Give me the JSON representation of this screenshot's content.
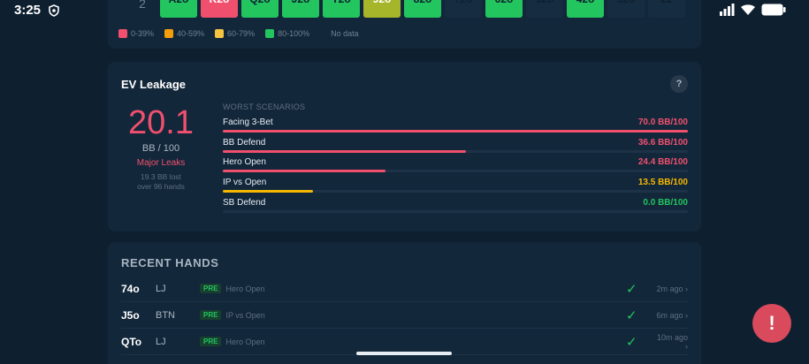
{
  "status_bar": {
    "time": "3:25"
  },
  "grid": {
    "row_label": "2",
    "cells": [
      {
        "label": "A2o",
        "color": "green"
      },
      {
        "label": "K2o",
        "color": "red"
      },
      {
        "label": "Q2o",
        "color": "green"
      },
      {
        "label": "J2o",
        "color": "green"
      },
      {
        "label": "T2o",
        "color": "green"
      },
      {
        "label": "92o",
        "color": "olive"
      },
      {
        "label": "82o",
        "color": "green"
      },
      {
        "label": "72o",
        "color": "empty"
      },
      {
        "label": "62o",
        "color": "green"
      },
      {
        "label": "52o",
        "color": "empty"
      },
      {
        "label": "42o",
        "color": "green"
      },
      {
        "label": "32o",
        "color": "empty"
      },
      {
        "label": "22",
        "color": "empty"
      }
    ],
    "legend": [
      {
        "label": "0-39%",
        "color": "#f0506e"
      },
      {
        "label": "40-59%",
        "color": "#f59e0b"
      },
      {
        "label": "60-79%",
        "color": "#f5c542"
      },
      {
        "label": "80-100%",
        "color": "#22c55e"
      },
      {
        "label": "No data",
        "color": ""
      }
    ]
  },
  "ev_leakage": {
    "title": "EV Leakage",
    "help": "?",
    "value": "20.1",
    "unit": "BB / 100",
    "status": "Major Leaks",
    "sub_line1": "19.3 BB lost",
    "sub_line2": "over 96 hands",
    "worst_label": "WORST SCENARIOS",
    "scenarios": [
      {
        "name": "Facing 3-Bet",
        "value": "70.0 BB/100",
        "fraction": 1.0,
        "color": "#f0506e"
      },
      {
        "name": "BB Defend",
        "value": "36.6 BB/100",
        "fraction": 0.523,
        "color": "#f0506e"
      },
      {
        "name": "Hero Open",
        "value": "24.4 BB/100",
        "fraction": 0.349,
        "color": "#f0506e"
      },
      {
        "name": "IP vs Open",
        "value": "13.5 BB/100",
        "fraction": 0.193,
        "color": "#f5b700"
      },
      {
        "name": "SB Defend",
        "value": "0.0 BB/100",
        "fraction": 0.0,
        "color": "#22c55e"
      }
    ]
  },
  "recent_hands": {
    "title": "RECENT HANDS",
    "rows": [
      {
        "cards": "74o",
        "pos": "LJ",
        "tag": "PRE",
        "scenario": "Hero Open",
        "time": "2m ago ›"
      },
      {
        "cards": "J5o",
        "pos": "BTN",
        "tag": "PRE",
        "scenario": "IP vs Open",
        "time": "6m ago ›"
      },
      {
        "cards": "QTo",
        "pos": "LJ",
        "tag": "PRE",
        "scenario": "Hero Open",
        "time": "10m ago ›"
      }
    ],
    "check": "✓"
  },
  "fab_label": "!"
}
